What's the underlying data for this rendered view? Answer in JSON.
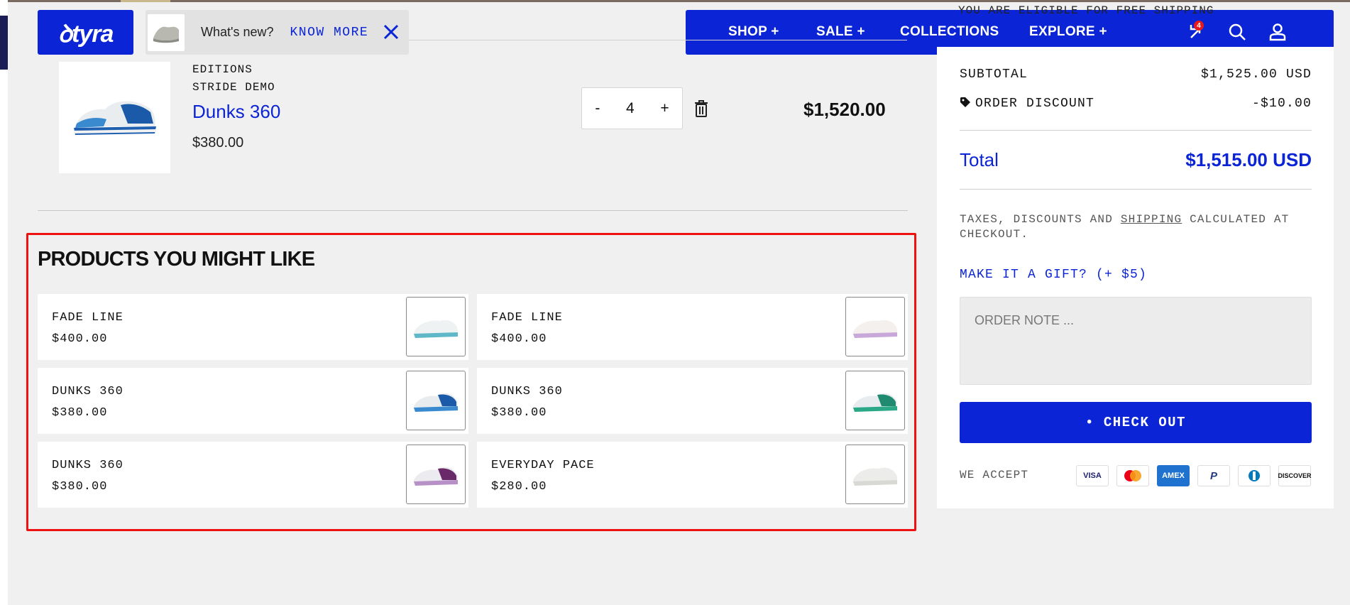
{
  "brand": {
    "logo_text": "ꝺtyra",
    "accent": "#0a24d6"
  },
  "notice": {
    "text": "What's new?",
    "link": "KNOW MORE"
  },
  "nav": {
    "items": [
      "SHOP +",
      "SALE +",
      "COLLECTIONS",
      "EXPLORE +"
    ],
    "cart_count": "4"
  },
  "panel_top_clipped": "YOU ARE ELIGIBLE FOR FREE SHIPPING",
  "cart_item": {
    "vendor": "EDITIONS",
    "variant": "STRIDE DEMO",
    "name": "Dunks 360",
    "unit_price": "$380.00",
    "quantity": "4",
    "minus": "-",
    "plus": "+",
    "line_price": "$1,520.00"
  },
  "recommendations": {
    "title": "PRODUCTS YOU MIGHT LIKE",
    "items": [
      {
        "name": "FADE LINE",
        "price": "$400.00"
      },
      {
        "name": "FADE LINE",
        "price": "$400.00"
      },
      {
        "name": "DUNKS 360",
        "price": "$380.00"
      },
      {
        "name": "DUNKS 360",
        "price": "$380.00"
      },
      {
        "name": "DUNKS 360",
        "price": "$380.00"
      },
      {
        "name": "EVERYDAY PACE",
        "price": "$280.00"
      }
    ]
  },
  "summary": {
    "subtotal_label": "SUBTOTAL",
    "subtotal_value": "$1,525.00 USD",
    "discount_label": "ORDER DISCOUNT",
    "discount_value": "-$10.00",
    "total_label": "Total",
    "total_value": "$1,515.00 USD",
    "tax_pre": "TAXES, DISCOUNTS AND ",
    "tax_link": "SHIPPING",
    "tax_post": " CALCULATED AT CHECKOUT.",
    "gift_label": "MAKE IT A GIFT? (+ $5)",
    "note_placeholder": "ORDER NOTE ...",
    "checkout_label": "• CHECK OUT",
    "accept_label": "WE ACCEPT",
    "payments": [
      "VISA",
      "mastercard",
      "AMEX",
      "P",
      "diners",
      "DISCOVER"
    ]
  }
}
